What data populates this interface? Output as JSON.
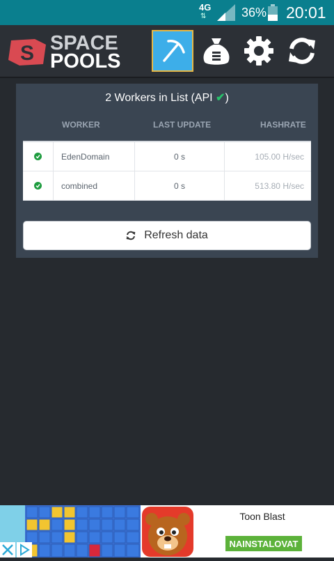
{
  "status_bar": {
    "network": "4G",
    "battery": "36%",
    "time": "20:01"
  },
  "header": {
    "logo_line1": "SPACE",
    "logo_line2": "POOLS",
    "nav": [
      {
        "icon": "pickaxe-icon",
        "active": true
      },
      {
        "icon": "money-bag-icon",
        "active": false
      },
      {
        "icon": "gear-icon",
        "active": false
      },
      {
        "icon": "refresh-icon",
        "active": false
      }
    ]
  },
  "workers_panel": {
    "title_prefix": "2 Workers in List (API",
    "title_suffix": ")",
    "columns": {
      "worker": "WORKER",
      "last_update": "LAST UPDATE",
      "hashrate": "HASHRATE"
    },
    "rows": [
      {
        "worker": "EdenDomain",
        "last_update": "0 s",
        "hashrate": "105.00 H/sec"
      },
      {
        "worker": "combined",
        "last_update": "0 s",
        "hashrate": "513.80 H/sec"
      }
    ],
    "refresh_label": "Refresh data"
  },
  "ad": {
    "title": "Toon Blast",
    "install_label": "NAINSTALOVAT"
  },
  "colors": {
    "accent": "#3daee9",
    "status_ok": "#1e9c3f",
    "install": "#5cb23a"
  }
}
